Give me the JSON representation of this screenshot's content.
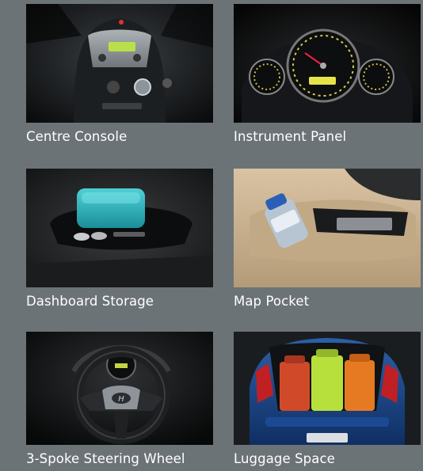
{
  "features": [
    {
      "label": "Centre Console",
      "image": "centre-console-photo"
    },
    {
      "label": "Instrument Panel",
      "image": "instrument-panel-photo"
    },
    {
      "label": "Dashboard Storage",
      "image": "dashboard-storage-photo"
    },
    {
      "label": "Map Pocket",
      "image": "map-pocket-photo"
    },
    {
      "label": "3-Spoke Steering Wheel",
      "image": "steering-wheel-photo"
    },
    {
      "label": "Luggage Space",
      "image": "luggage-space-photo"
    }
  ]
}
